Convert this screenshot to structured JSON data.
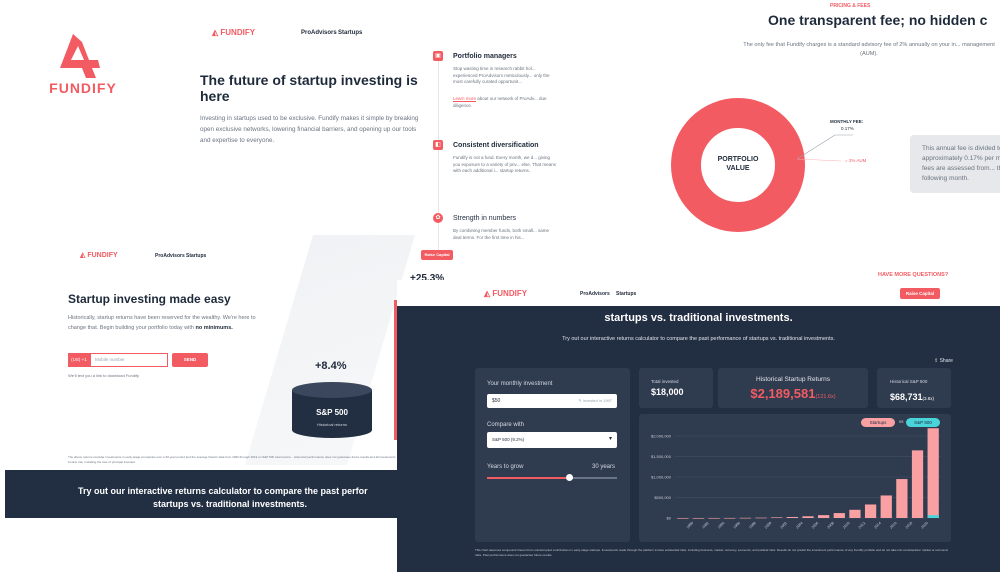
{
  "brand": {
    "name": "FUNDIFY",
    "big_name": "FUNDIFY",
    "accent": "#f25b62",
    "navy": "#222e41"
  },
  "nav": {
    "links": [
      "ProAdvisors",
      "Startups"
    ],
    "cta": "Raise Capital"
  },
  "hero": {
    "title": "The future of startup investing is here",
    "body": "Investing in startups used to be exclusive. Fundify makes it simple by breaking open exclusive networks, lowering financial barriers, and opening up our tools and expertise to everyone."
  },
  "features": [
    {
      "title": "Portfolio managers",
      "body": "Stop wasting time in research rabbit hol... experienced ProAdvisors meticulously... only the most carefully curated opportunit...",
      "link": "Learn more",
      "link_rest": " about our network of ProAdv... due diligence."
    },
    {
      "title": "Consistent diversification",
      "body": "Fundify is not a fund. Every month, we d... giving you exposure to a variety of priv... else. That means with each additional i... startup returns."
    },
    {
      "title": "Strength in numbers",
      "body": "By combining member funds, both small... same deal terms. For the first time in his..."
    }
  ],
  "pricing": {
    "eyebrow": "PRICING & FEES",
    "title": "One transparent fee; no hidden c",
    "desc": "The only fee that Fundify charges is a standard advisory fee of 2% annually on your in... management (AUM).",
    "donut_label": "PORTFOLIO VALUE",
    "monthly_fee_label": "MONTHLY FEE:",
    "monthly_fee_value": "0.17%",
    "annual_label": "= 2% AUM",
    "note": "This annual fee is divided to approximately 0.17% per m... The fees are assessed from... the following month.",
    "more_q": "HAVE MORE QUESTIONS?"
  },
  "landing": {
    "title": "Startup investing made easy",
    "body": "Historically, startup returns have been reserved for the wealthy. We're here to change that. Begin building your portfolio today with ",
    "body_bold": "no minimums.",
    "phone_code": "(US) +1",
    "phone_placeholder": "Mobile number",
    "send": "SEND",
    "note": "We'll text you a link to download Fundify",
    "sp_pct": "+8.4%",
    "sp_name": "S&P 500",
    "sp_sub": "Historical returns",
    "startup_pct": "+25.3%",
    "fine": "The above returns consider investments in early-stage companies over a 30-year period and the average historic data from 1990 through 2019 on S&P 500 total returns... Historical performance does not guarantee future results and all investments involve risk, including the loss of principal invested.",
    "banner": "Try out our interactive returns calculator to compare the past performance of startups vs. traditional investments.",
    "banner_line1": "Try out our interactive returns calculator to compare the past perfor",
    "banner_line2": "startups vs. traditional investments."
  },
  "calculator": {
    "partial_title": "Try out our interactive returns calculator to compare the past performance of",
    "title_line2": "startups vs. traditional investments.",
    "subtitle": "Try out our interactive returns calculator to compare the past performance of startups vs. traditional investments.",
    "share": "Share",
    "monthly_label": "Your monthly investment",
    "monthly_value": "$50",
    "monthly_hint": "invested in 1997",
    "compare_label": "Compare with",
    "compare_value": "S&P 500 (9.2%)",
    "years_label": "Years to grow",
    "years_value": "30 years",
    "slider_fraction": 0.63,
    "total_invested_label": "Total invested",
    "total_invested": "$18,000",
    "hist_label": "Historical Startup Returns",
    "hist_value": "$2,189,581",
    "hist_mult": "(121.6x)",
    "sp_label": "Historical S&P 500",
    "sp_value": "$68,731",
    "sp_mult": "(3.8x)",
    "legend_startups": "Startups",
    "legend_vs": "vs",
    "legend_sp": "S&P 500",
    "disclaimer": "This chart assumes compound interest from uninterrupted contributions in early-stage startups. Investments made through the platform involve substantial risks, including business, market, currency, economic, and political risks. Results do not predict the investment performance of any Fundify portfolio and do not take into consideration market or economic risks. Past performance does not guarantee future results.",
    "startup_color": "#f8a0a2",
    "sp_color": "#48d4d8"
  },
  "chart_data": {
    "type": "bar",
    "categories": [
      "1990",
      "1992",
      "1994",
      "1996",
      "1998",
      "2000",
      "2002",
      "2004",
      "2006",
      "2008",
      "2010",
      "2012",
      "2014",
      "2016",
      "2018",
      "2020"
    ],
    "series": [
      {
        "name": "Startups",
        "values": [
          0,
          0,
          500,
          1500,
          4000,
          8000,
          15000,
          25000,
          42000,
          70000,
          120000,
          200000,
          330000,
          550000,
          950000,
          1650000,
          2189581
        ]
      },
      {
        "name": "S&P 500",
        "values": [
          0,
          0,
          0,
          0,
          0,
          0,
          0,
          0,
          0,
          0,
          0,
          0,
          0,
          0,
          0,
          0,
          68731
        ]
      }
    ],
    "ytick_labels": [
      "$2,000,000",
      "$1,500,000",
      "$1,000,000",
      "$500,000",
      "$0"
    ],
    "ylim": [
      0,
      2000000
    ]
  }
}
